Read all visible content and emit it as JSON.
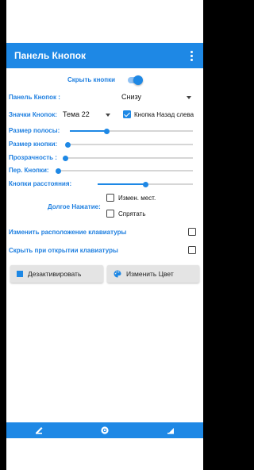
{
  "app_bar": {
    "title": "Панель Кнопок"
  },
  "hide_buttons": {
    "label": "Скрыть кнопки",
    "on": true
  },
  "panel_row": {
    "label": "Панель Кнопок :",
    "value": "Снизу"
  },
  "icons_row": {
    "label": "Значки Кнопок:",
    "value": "Тема 22",
    "back_left_label": "Кнопка Назад слева",
    "back_left_checked": true
  },
  "sliders": [
    {
      "label": "Размер полосы:",
      "level": 0.3
    },
    {
      "label": "Размер кнопки:",
      "level": 0.0
    },
    {
      "label": "Прозрачность :",
      "level": 0.0
    },
    {
      "label": "Пер. Кнопки:",
      "level": 0.0
    },
    {
      "label": "Кнопки расстояния:",
      "level": 0.5
    }
  ],
  "long_press": {
    "label": "Долгое Нажатие:",
    "options": [
      {
        "label": "Измен. мест.",
        "checked": false
      },
      {
        "label": "Спрятать",
        "checked": false
      }
    ]
  },
  "change_keyboard_layout": {
    "label": "Изменить расположение клавиатуры",
    "checked": false
  },
  "hide_on_keyboard": {
    "label": "Скрыть при открытии клавиатуры",
    "checked": false
  },
  "buttons": {
    "deactivate": "Дезактивировать",
    "change_color": "Изменить Цвет"
  },
  "colors": {
    "accent": "#1e88e5",
    "label": "#1e7fe0"
  }
}
